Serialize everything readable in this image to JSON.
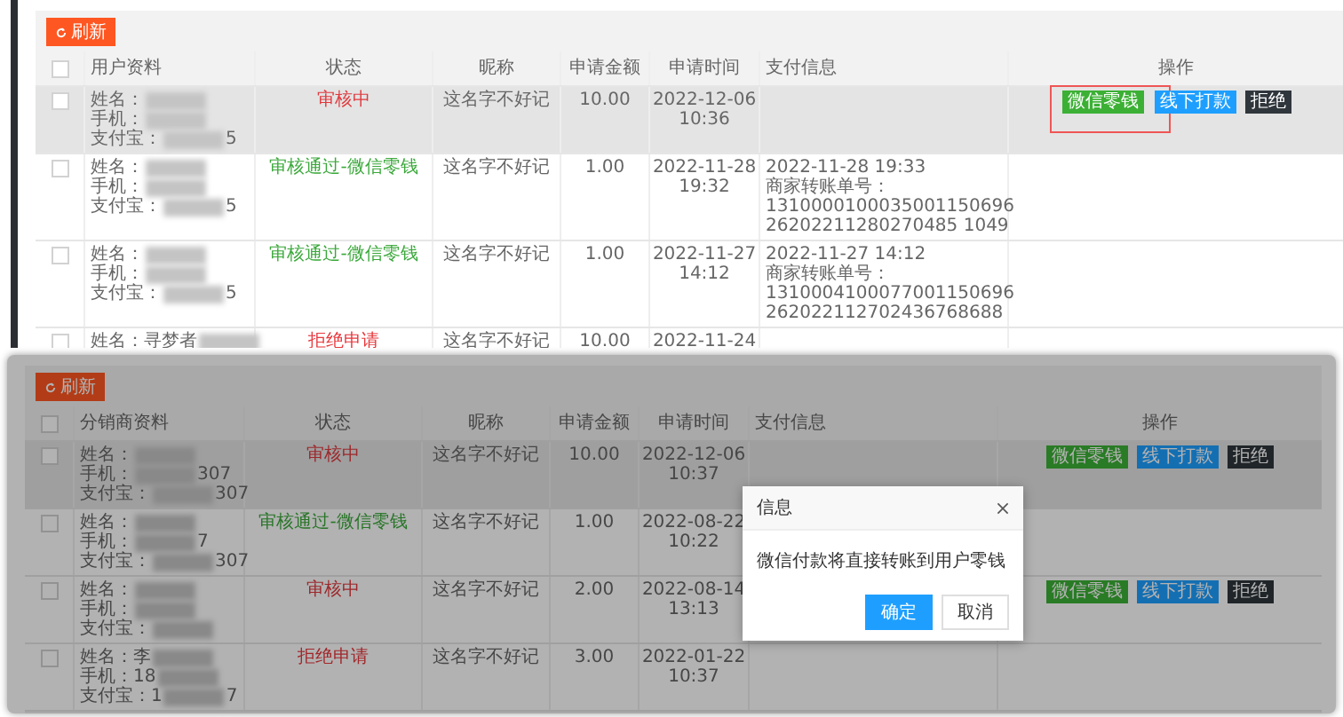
{
  "panels": [
    {
      "dimmed": false,
      "refresh_button": "刷新",
      "header_checked": false,
      "columns": [
        "用户资料",
        "状态",
        "昵称",
        "申请金额",
        "申请时间",
        "支付信息",
        "操作"
      ],
      "rows": [
        {
          "selected": true,
          "info": [
            {
              "label": "姓名："
            },
            {
              "label": "手机："
            },
            {
              "label": "支付宝：",
              "tail": "5"
            }
          ],
          "status": {
            "text": "审核中",
            "kind": "pending"
          },
          "nickname": "这名字不好记",
          "amount": "10.00",
          "time": [
            "2022-12-06",
            "10:36"
          ],
          "pay_info": [],
          "actions": [
            {
              "label": "微信零钱",
              "kind": "wechat",
              "highlighted": true
            },
            {
              "label": "线下打款",
              "kind": "offline",
              "highlighted": false
            },
            {
              "label": "拒绝",
              "kind": "reject",
              "highlighted": false
            }
          ]
        },
        {
          "selected": false,
          "info": [
            {
              "label": "姓名："
            },
            {
              "label": "手机："
            },
            {
              "label": "支付宝：",
              "tail": "5"
            }
          ],
          "status": {
            "text": "审核通过-微信零钱",
            "kind": "approved"
          },
          "nickname": "这名字不好记",
          "amount": "1.00",
          "time": [
            "2022-11-28",
            "19:32"
          ],
          "pay_info": [
            "2022-11-28 19:33",
            "商家转账单号：",
            "1310000100035001150696",
            "26202211280270485 1049"
          ],
          "actions": []
        },
        {
          "selected": false,
          "info": [
            {
              "label": "姓名："
            },
            {
              "label": "手机："
            },
            {
              "label": "支付宝：",
              "tail": "5"
            }
          ],
          "status": {
            "text": "审核通过-微信零钱",
            "kind": "approved"
          },
          "nickname": "这名字不好记",
          "amount": "1.00",
          "time": [
            "2022-11-27",
            "14:12"
          ],
          "pay_info": [
            "2022-11-27 14:12",
            "商家转账单号：",
            "1310004100077001150696",
            "262022112702436768688"
          ],
          "actions": []
        },
        {
          "selected": false,
          "info": [
            {
              "label": "姓名：寻梦者"
            }
          ],
          "status": {
            "text": "拒绝申请",
            "kind": "rejected"
          },
          "nickname": "这名字不好记",
          "amount": "10.00",
          "time": [
            "2022-11-24"
          ],
          "pay_info": [],
          "actions": []
        }
      ]
    },
    {
      "dimmed": true,
      "refresh_button": "刷新",
      "header_checked": false,
      "columns": [
        "分销商资料",
        "状态",
        "昵称",
        "申请金额",
        "申请时间",
        "支付信息",
        "操作"
      ],
      "rows": [
        {
          "selected": true,
          "info": [
            {
              "label": "姓名："
            },
            {
              "label": "手机：",
              "tail": "307"
            },
            {
              "label": "支付宝：",
              "tail": "307"
            }
          ],
          "status": {
            "text": "审核中",
            "kind": "pending"
          },
          "nickname": "这名字不好记",
          "amount": "10.00",
          "time": [
            "2022-12-06",
            "10:37"
          ],
          "pay_info": [],
          "actions": [
            {
              "label": "微信零钱",
              "kind": "wechat",
              "highlighted": false
            },
            {
              "label": "线下打款",
              "kind": "offline",
              "highlighted": false
            },
            {
              "label": "拒绝",
              "kind": "reject",
              "highlighted": false
            }
          ]
        },
        {
          "selected": false,
          "info": [
            {
              "label": "姓名："
            },
            {
              "label": "手机：",
              "tail": "7"
            },
            {
              "label": "支付宝：",
              "tail": "307"
            }
          ],
          "status": {
            "text": "审核通过-微信零钱",
            "kind": "approved"
          },
          "nickname": "这名字不好记",
          "amount": "1.00",
          "time": [
            "2022-08-22",
            "10:22"
          ],
          "pay_info": [],
          "actions": []
        },
        {
          "selected": false,
          "info": [
            {
              "label": "姓名："
            },
            {
              "label": "手机："
            },
            {
              "label": "支付宝："
            }
          ],
          "status": {
            "text": "审核中",
            "kind": "pending"
          },
          "nickname": "这名字不好记",
          "amount": "2.00",
          "time": [
            "2022-08-14",
            "13:13"
          ],
          "pay_info": [],
          "actions": [
            {
              "label": "微信零钱",
              "kind": "wechat",
              "highlighted": false
            },
            {
              "label": "线下打款",
              "kind": "offline",
              "highlighted": false
            },
            {
              "label": "拒绝",
              "kind": "reject",
              "highlighted": false
            }
          ]
        },
        {
          "selected": false,
          "info": [
            {
              "label": "姓名：李"
            },
            {
              "label": "手机：18"
            },
            {
              "label": "支付宝：1",
              "tail": "7"
            }
          ],
          "status": {
            "text": "拒绝申请",
            "kind": "rejected"
          },
          "nickname": "这名字不好记",
          "amount": "3.00",
          "time": [
            "2022-01-22",
            "10:37"
          ],
          "pay_info": [],
          "actions": []
        }
      ],
      "dialog": {
        "title": "信息",
        "message": "微信付款将直接转账到用户零钱",
        "confirm": "确定",
        "cancel": "取消"
      }
    }
  ]
}
